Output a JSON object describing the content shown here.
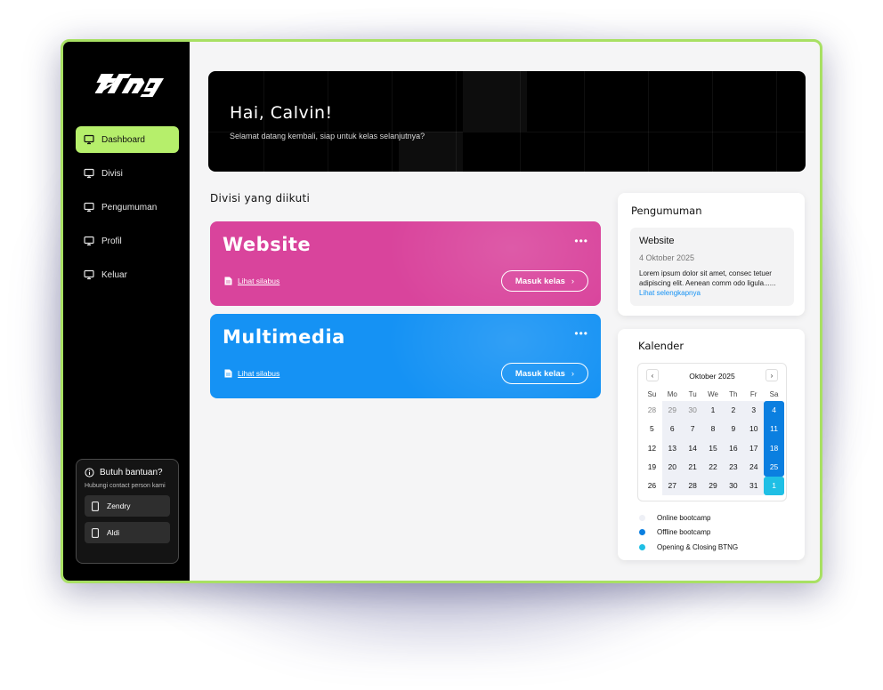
{
  "sidebar": {
    "items": [
      {
        "label": "Dashboard",
        "icon": "monitor-icon",
        "active": true
      },
      {
        "label": "Divisi",
        "icon": "monitor-icon"
      },
      {
        "label": "Pengumuman",
        "icon": "monitor-icon"
      },
      {
        "label": "Profil",
        "icon": "monitor-icon"
      },
      {
        "label": "Keluar",
        "icon": "monitor-icon"
      }
    ],
    "help": {
      "title": "Butuh bantuan?",
      "subtitle": "Hubungi contact person kami",
      "contacts": [
        "Zendry",
        "Aldi"
      ]
    }
  },
  "hero": {
    "greeting": "Hai, Calvin!",
    "subtitle": "Selamat datang kembali, siap untuk kelas selanjutnya?"
  },
  "divisions": {
    "title": "Divisi yang diikuti",
    "items": [
      {
        "name": "Website",
        "syllabus": "Lihat silabus",
        "enter": "Masuk kelas",
        "color": "#d9449c"
      },
      {
        "name": "Multimedia",
        "syllabus": "Lihat silabus",
        "enter": "Masuk kelas",
        "color": "#1592f4"
      }
    ]
  },
  "announcement": {
    "title": "Pengumuman",
    "item_title": "Website",
    "item_date": "4 Oktober 2025",
    "item_body": "Lorem ipsum dolor sit amet, consec tetuer adipiscing elit. Aenean comm odo ligula...... ",
    "item_link": "Lihat selengkapnya"
  },
  "calendar": {
    "title": "Kalender",
    "month": "Oktober 2025",
    "weekdays": [
      "Su",
      "Mo",
      "Tu",
      "We",
      "Th",
      "Fr",
      "Sa"
    ],
    "weeks": [
      [
        "28",
        "29",
        "30",
        "1",
        "2",
        "3",
        "4"
      ],
      [
        "5",
        "6",
        "7",
        "8",
        "9",
        "10",
        "11"
      ],
      [
        "12",
        "13",
        "14",
        "15",
        "16",
        "17",
        "18"
      ],
      [
        "19",
        "20",
        "21",
        "22",
        "23",
        "24",
        "25"
      ],
      [
        "26",
        "27",
        "28",
        "29",
        "30",
        "31",
        "1"
      ]
    ],
    "legend": [
      {
        "label": "Online bootcamp",
        "color": "#eef0f6"
      },
      {
        "label": "Offline bootcamp",
        "color": "#0b7fe0"
      },
      {
        "label": "Opening & Closing BTNG",
        "color": "#1fbfe5"
      }
    ]
  },
  "colors": {
    "accent": "#b6ef6b",
    "frame_border": "#a8e063"
  }
}
